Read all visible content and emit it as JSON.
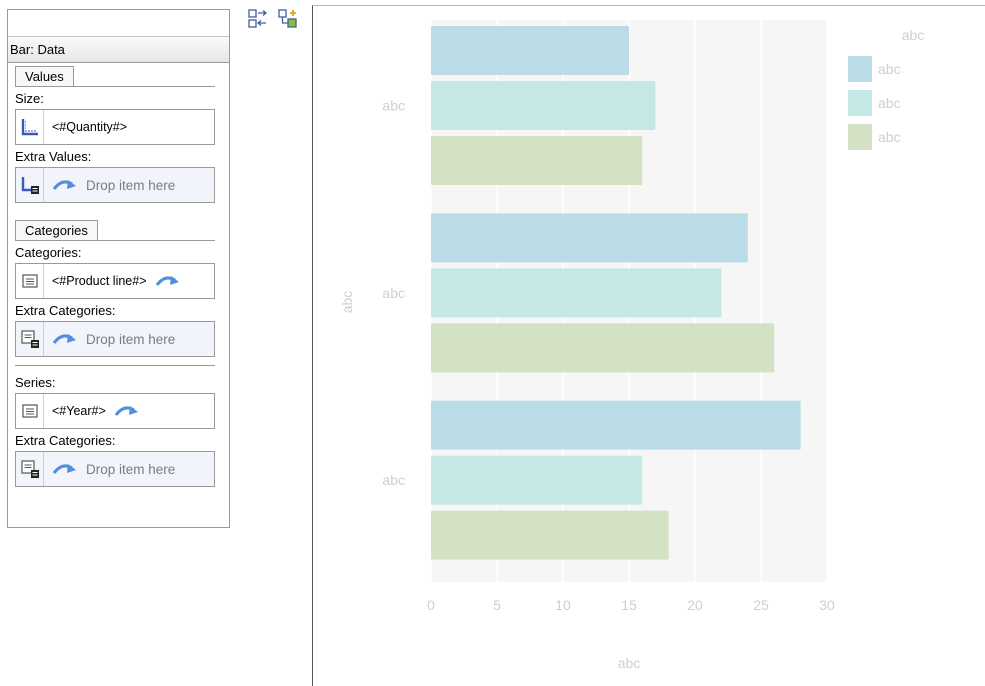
{
  "data_panel": {
    "top_value": "",
    "title": "Bar: Data",
    "values_group": {
      "tab": "Values",
      "size_label": "Size:",
      "size_value": "<#Quantity#>",
      "extra_values_label": "Extra Values:",
      "extra_values_placeholder": "Drop item here"
    },
    "categories_group": {
      "tab": "Categories",
      "categories_label": "Categories:",
      "categories_value": "<#Product line#>",
      "extra_categories_label": "Extra Categories:",
      "extra_categories_placeholder": "Drop item here"
    },
    "series_group": {
      "series_label": "Series:",
      "series_value": "<#Year#>",
      "extra_categories_label": "Extra Categories:",
      "extra_categories_placeholder": "Drop item here"
    }
  },
  "toolbar": {
    "icons": [
      "swap-data-icon",
      "add-item-icon"
    ]
  },
  "colors": {
    "series": [
      "#b9dce6",
      "#c4e8e6",
      "#d3e1c5"
    ],
    "plot_background": "#f6f6f6",
    "label_text": "#cfcfcf",
    "arrow_blue": "#4f8fdc"
  },
  "chart_data": {
    "type": "bar",
    "orientation": "horizontal",
    "title": "",
    "categories": [
      "abc",
      "abc",
      "abc"
    ],
    "series": [
      {
        "name": "abc",
        "values": [
          15,
          24,
          28
        ]
      },
      {
        "name": "abc",
        "values": [
          17,
          22,
          16
        ]
      },
      {
        "name": "abc",
        "values": [
          16,
          26,
          18
        ]
      }
    ],
    "xlabel": "abc",
    "ylabel": "abc",
    "xlim": [
      0,
      30
    ],
    "xticks": [
      "0",
      "5",
      "10",
      "15",
      "20",
      "25",
      "30"
    ],
    "legend_title": "abc",
    "legend_position": "top-right",
    "grid": true
  }
}
